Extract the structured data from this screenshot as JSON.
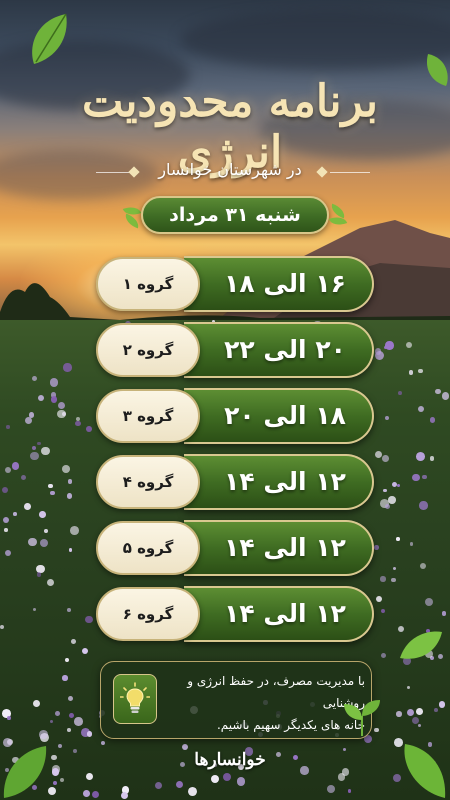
{
  "title": "برنامه محدودیت انرژی",
  "subtitle": "در شهرستان خوانسار",
  "date": "شنبه ۳۱ مرداد",
  "schedule": [
    {
      "group": "گروه ۱",
      "hours": "۱۶ الی ۱۸"
    },
    {
      "group": "گروه ۲",
      "hours": "۲۰ الی ۲۲"
    },
    {
      "group": "گروه ۳",
      "hours": "۱۸ الی ۲۰"
    },
    {
      "group": "گروه ۴",
      "hours": "۱۲ الی ۱۴"
    },
    {
      "group": "گروه ۵",
      "hours": "۱۲ الی ۱۴"
    },
    {
      "group": "گروه ۶",
      "hours": "۱۲ الی ۱۴"
    }
  ],
  "info": {
    "line1": "با مدیریت مصرف، در حفظ انرژی و روشنایی",
    "line2": "خانه های یکدیگر سهیم باشیم.",
    "icon": "lightbulb-icon"
  },
  "footer": "خوانسارها",
  "colors": {
    "accent_green": "#3f6c22",
    "gold_border": "#d9c890",
    "cream": "#f6efdc",
    "title_gold": "#f6e4b4"
  }
}
